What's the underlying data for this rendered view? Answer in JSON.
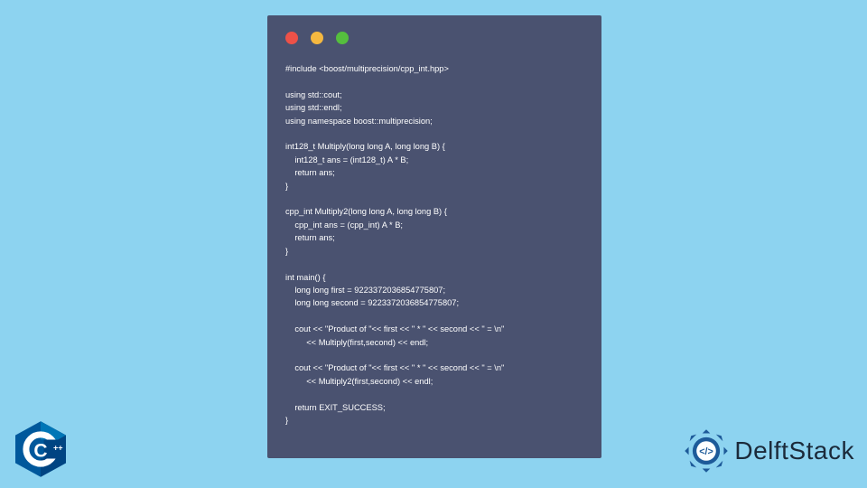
{
  "code": {
    "lines": [
      "#include <boost/multiprecision/cpp_int.hpp>",
      "",
      "using std::cout;",
      "using std::endl;",
      "using namespace boost::multiprecision;",
      "",
      "int128_t Multiply(long long A, long long B) {",
      "    int128_t ans = (int128_t) A * B;",
      "    return ans;",
      "}",
      "",
      "cpp_int Multiply2(long long A, long long B) {",
      "    cpp_int ans = (cpp_int) A * B;",
      "    return ans;",
      "}",
      "",
      "int main() {",
      "    long long first = 9223372036854775807;",
      "    long long second = 9223372036854775807;",
      "",
      "    cout << \"Product of \"<< first << \" * \" << second << \" = \\n\"",
      "         << Multiply(first,second) << endl;",
      "",
      "    cout << \"Product of \"<< first << \" * \" << second << \" = \\n\"",
      "         << Multiply2(first,second) << endl;",
      "",
      "    return EXIT_SUCCESS;",
      "}"
    ]
  },
  "badges": {
    "cpp_label": "C++",
    "brand_name": "DelftStack"
  }
}
